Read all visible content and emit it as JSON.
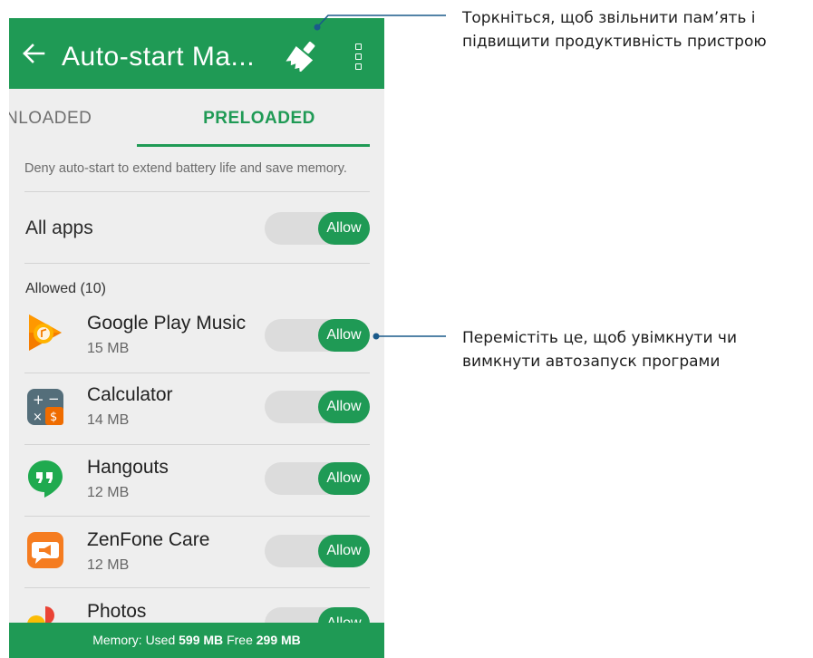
{
  "app_bar": {
    "title": "Auto-start Ma...",
    "back_icon": "arrow-left-icon",
    "clean_icon": "broom-icon",
    "menu_icon": "more-vert-icon"
  },
  "tabs": {
    "downloaded": "NLOADED",
    "preloaded": "PRELOADED",
    "active": "preloaded"
  },
  "hint": "Deny auto-start to extend battery life and save memory.",
  "all_apps": {
    "label": "All apps",
    "toggle": "Allow"
  },
  "section_label": "Allowed (10)",
  "apps": [
    {
      "name": "Google Play Music",
      "size": "15 MB",
      "toggle": "Allow",
      "icon": "google-play-music-icon"
    },
    {
      "name": "Calculator",
      "size": "14 MB",
      "toggle": "Allow",
      "icon": "calculator-icon"
    },
    {
      "name": "Hangouts",
      "size": "12 MB",
      "toggle": "Allow",
      "icon": "hangouts-icon"
    },
    {
      "name": "ZenFone Care",
      "size": "12 MB",
      "toggle": "Allow",
      "icon": "zenfone-care-icon"
    },
    {
      "name": "Photos",
      "size": "",
      "toggle": "Allow",
      "icon": "photos-icon"
    }
  ],
  "memory": {
    "label": "Memory:",
    "used_label": "Used",
    "used_value": "599 MB",
    "free_label": "Free",
    "free_value": "299 MB"
  },
  "callouts": {
    "clean": [
      "Торкніться, щоб звільнити пам’ять і",
      "підвищити продуктивність пристрою"
    ],
    "toggle": [
      "Перемістіть це, щоб увімкнути чи",
      "вимкнути автозапуск програми"
    ]
  },
  "colors": {
    "accent": "#1f9a55",
    "callout_line": "#1a5a8a"
  }
}
